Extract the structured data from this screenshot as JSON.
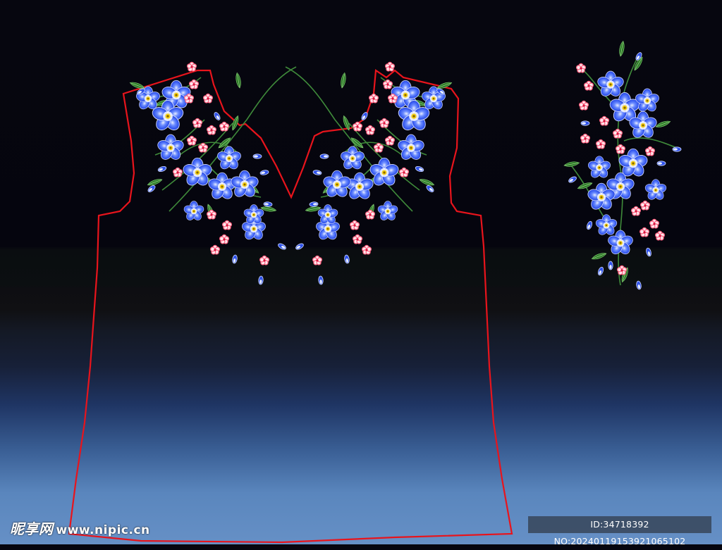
{
  "colors": {
    "outline": "#e8141c",
    "petal_blue": "#3a64ff",
    "petal_light": "#cfd9ff",
    "petal_dark": "#1b2fb3",
    "pink": "#ff6f8a",
    "pink_light": "#ffe3ea",
    "leaf": "#2d7a2a",
    "leaf_light": "#7ccf6a",
    "center": "#f7d21a"
  },
  "icons": {
    "flower": "embroidered-blue-flower",
    "blossom": "embroidered-pink-blossom",
    "bud": "blue-bud"
  },
  "watermark": {
    "brand": "昵享网",
    "site": "www.nipic.cn",
    "id_text": "ID:34718392 NO:20240119153921065102"
  }
}
